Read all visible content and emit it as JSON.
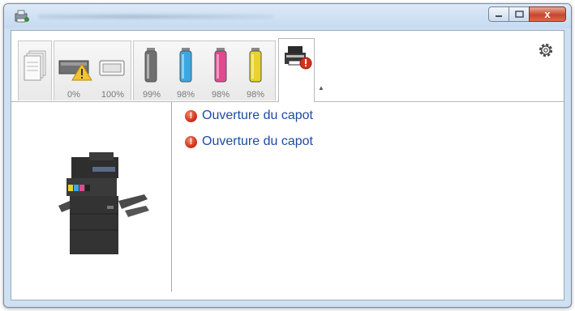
{
  "window": {
    "close_glyph": "x",
    "minimize_glyph": "–",
    "maximize_glyph": "□"
  },
  "toolbar": {
    "tabs": [
      {
        "name": "paper-tab",
        "icon": "paper-stack-icon",
        "label": ""
      },
      {
        "name": "waste-toner-tab",
        "icon": "waste-toner-warning-icon",
        "label": "0%"
      },
      {
        "name": "tray-tab",
        "icon": "paper-tray-icon",
        "label": "100%"
      },
      {
        "name": "toner-black",
        "icon": "toner-black-icon",
        "label": "99%",
        "color": "#6f6f6f"
      },
      {
        "name": "toner-cyan",
        "icon": "toner-cyan-icon",
        "label": "98%",
        "color": "#3aa7e2"
      },
      {
        "name": "toner-magenta",
        "icon": "toner-magenta-icon",
        "label": "98%",
        "color": "#e04a8f"
      },
      {
        "name": "toner-yellow",
        "icon": "toner-yellow-icon",
        "label": "98%",
        "color": "#e8d32a"
      },
      {
        "name": "device-status-tab",
        "icon": "printer-error-icon",
        "label": ""
      }
    ],
    "collapse_glyph": "▲"
  },
  "messages": [
    {
      "icon": "error-icon",
      "text": "Ouverture du capot"
    },
    {
      "icon": "error-icon",
      "text": "Ouverture du capot"
    }
  ],
  "colors": {
    "message_text": "#1f4aa3",
    "error_red": "#d5311c"
  }
}
